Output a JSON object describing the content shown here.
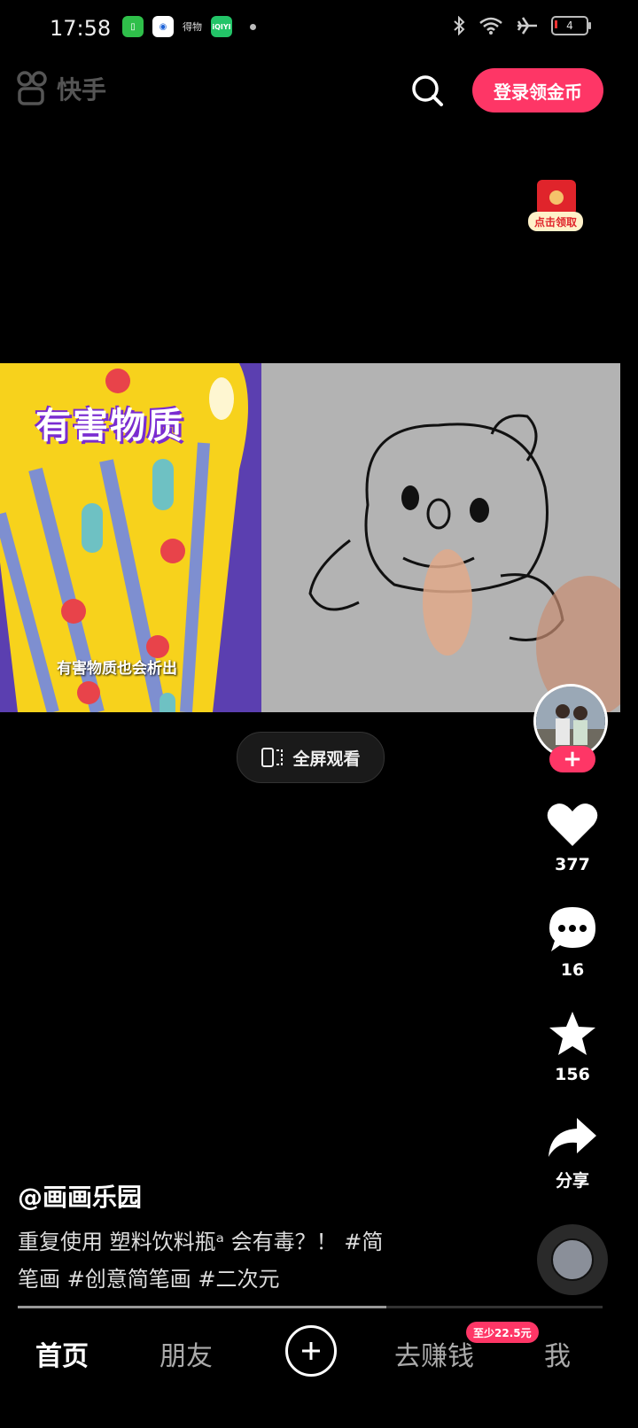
{
  "status_bar": {
    "time": "17:58",
    "app_text": "得物",
    "iqiyi": "iQIYI",
    "battery": "4"
  },
  "header": {
    "logo": "快手",
    "login_button": "登录领金币"
  },
  "redpacket": {
    "tag": "点击领取"
  },
  "video": {
    "title": "有害物质",
    "subtitle": "有害物质也会析出"
  },
  "fullscreen_label": "全屏观看",
  "actions": {
    "likes": "377",
    "comments": "16",
    "favorites": "156",
    "share": "分享"
  },
  "caption": {
    "author": "@画画乐园",
    "line1": "重复使用 塑料饮料瓶ᵃ 会有毒？！  #简",
    "line2": "笔画 #创意简笔画 #二次元"
  },
  "progress": {
    "fraction": 0.63
  },
  "nav": {
    "home": "首页",
    "friends": "朋友",
    "earn": "去赚钱",
    "earn_badge": "至少22.5元",
    "me": "我"
  },
  "colors": {
    "accent": "#fe3666"
  }
}
